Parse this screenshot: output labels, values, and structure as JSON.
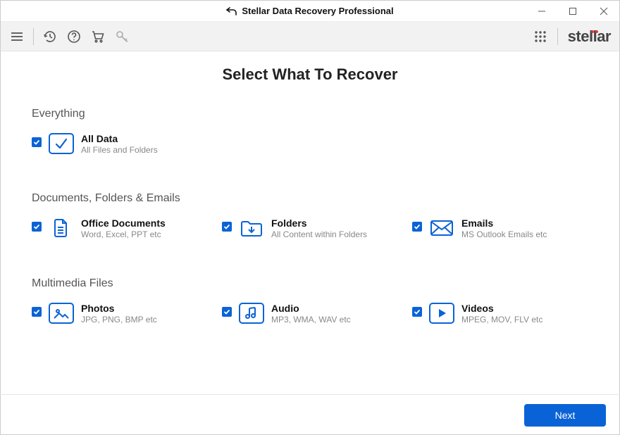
{
  "window": {
    "title": "Stellar Data Recovery Professional"
  },
  "brand": "stellar",
  "page_title": "Select What To Recover",
  "sections": {
    "everything": {
      "title": "Everything",
      "all_data": {
        "title": "All Data",
        "sub": "All Files and Folders"
      }
    },
    "docs": {
      "title": "Documents, Folders & Emails",
      "office": {
        "title": "Office Documents",
        "sub": "Word, Excel, PPT etc"
      },
      "folders": {
        "title": "Folders",
        "sub": "All Content within Folders"
      },
      "emails": {
        "title": "Emails",
        "sub": "MS Outlook Emails etc"
      }
    },
    "media": {
      "title": "Multimedia Files",
      "photos": {
        "title": "Photos",
        "sub": "JPG, PNG, BMP etc"
      },
      "audio": {
        "title": "Audio",
        "sub": "MP3, WMA, WAV etc"
      },
      "videos": {
        "title": "Videos",
        "sub": "MPEG, MOV, FLV etc"
      }
    }
  },
  "footer": {
    "next": "Next"
  }
}
